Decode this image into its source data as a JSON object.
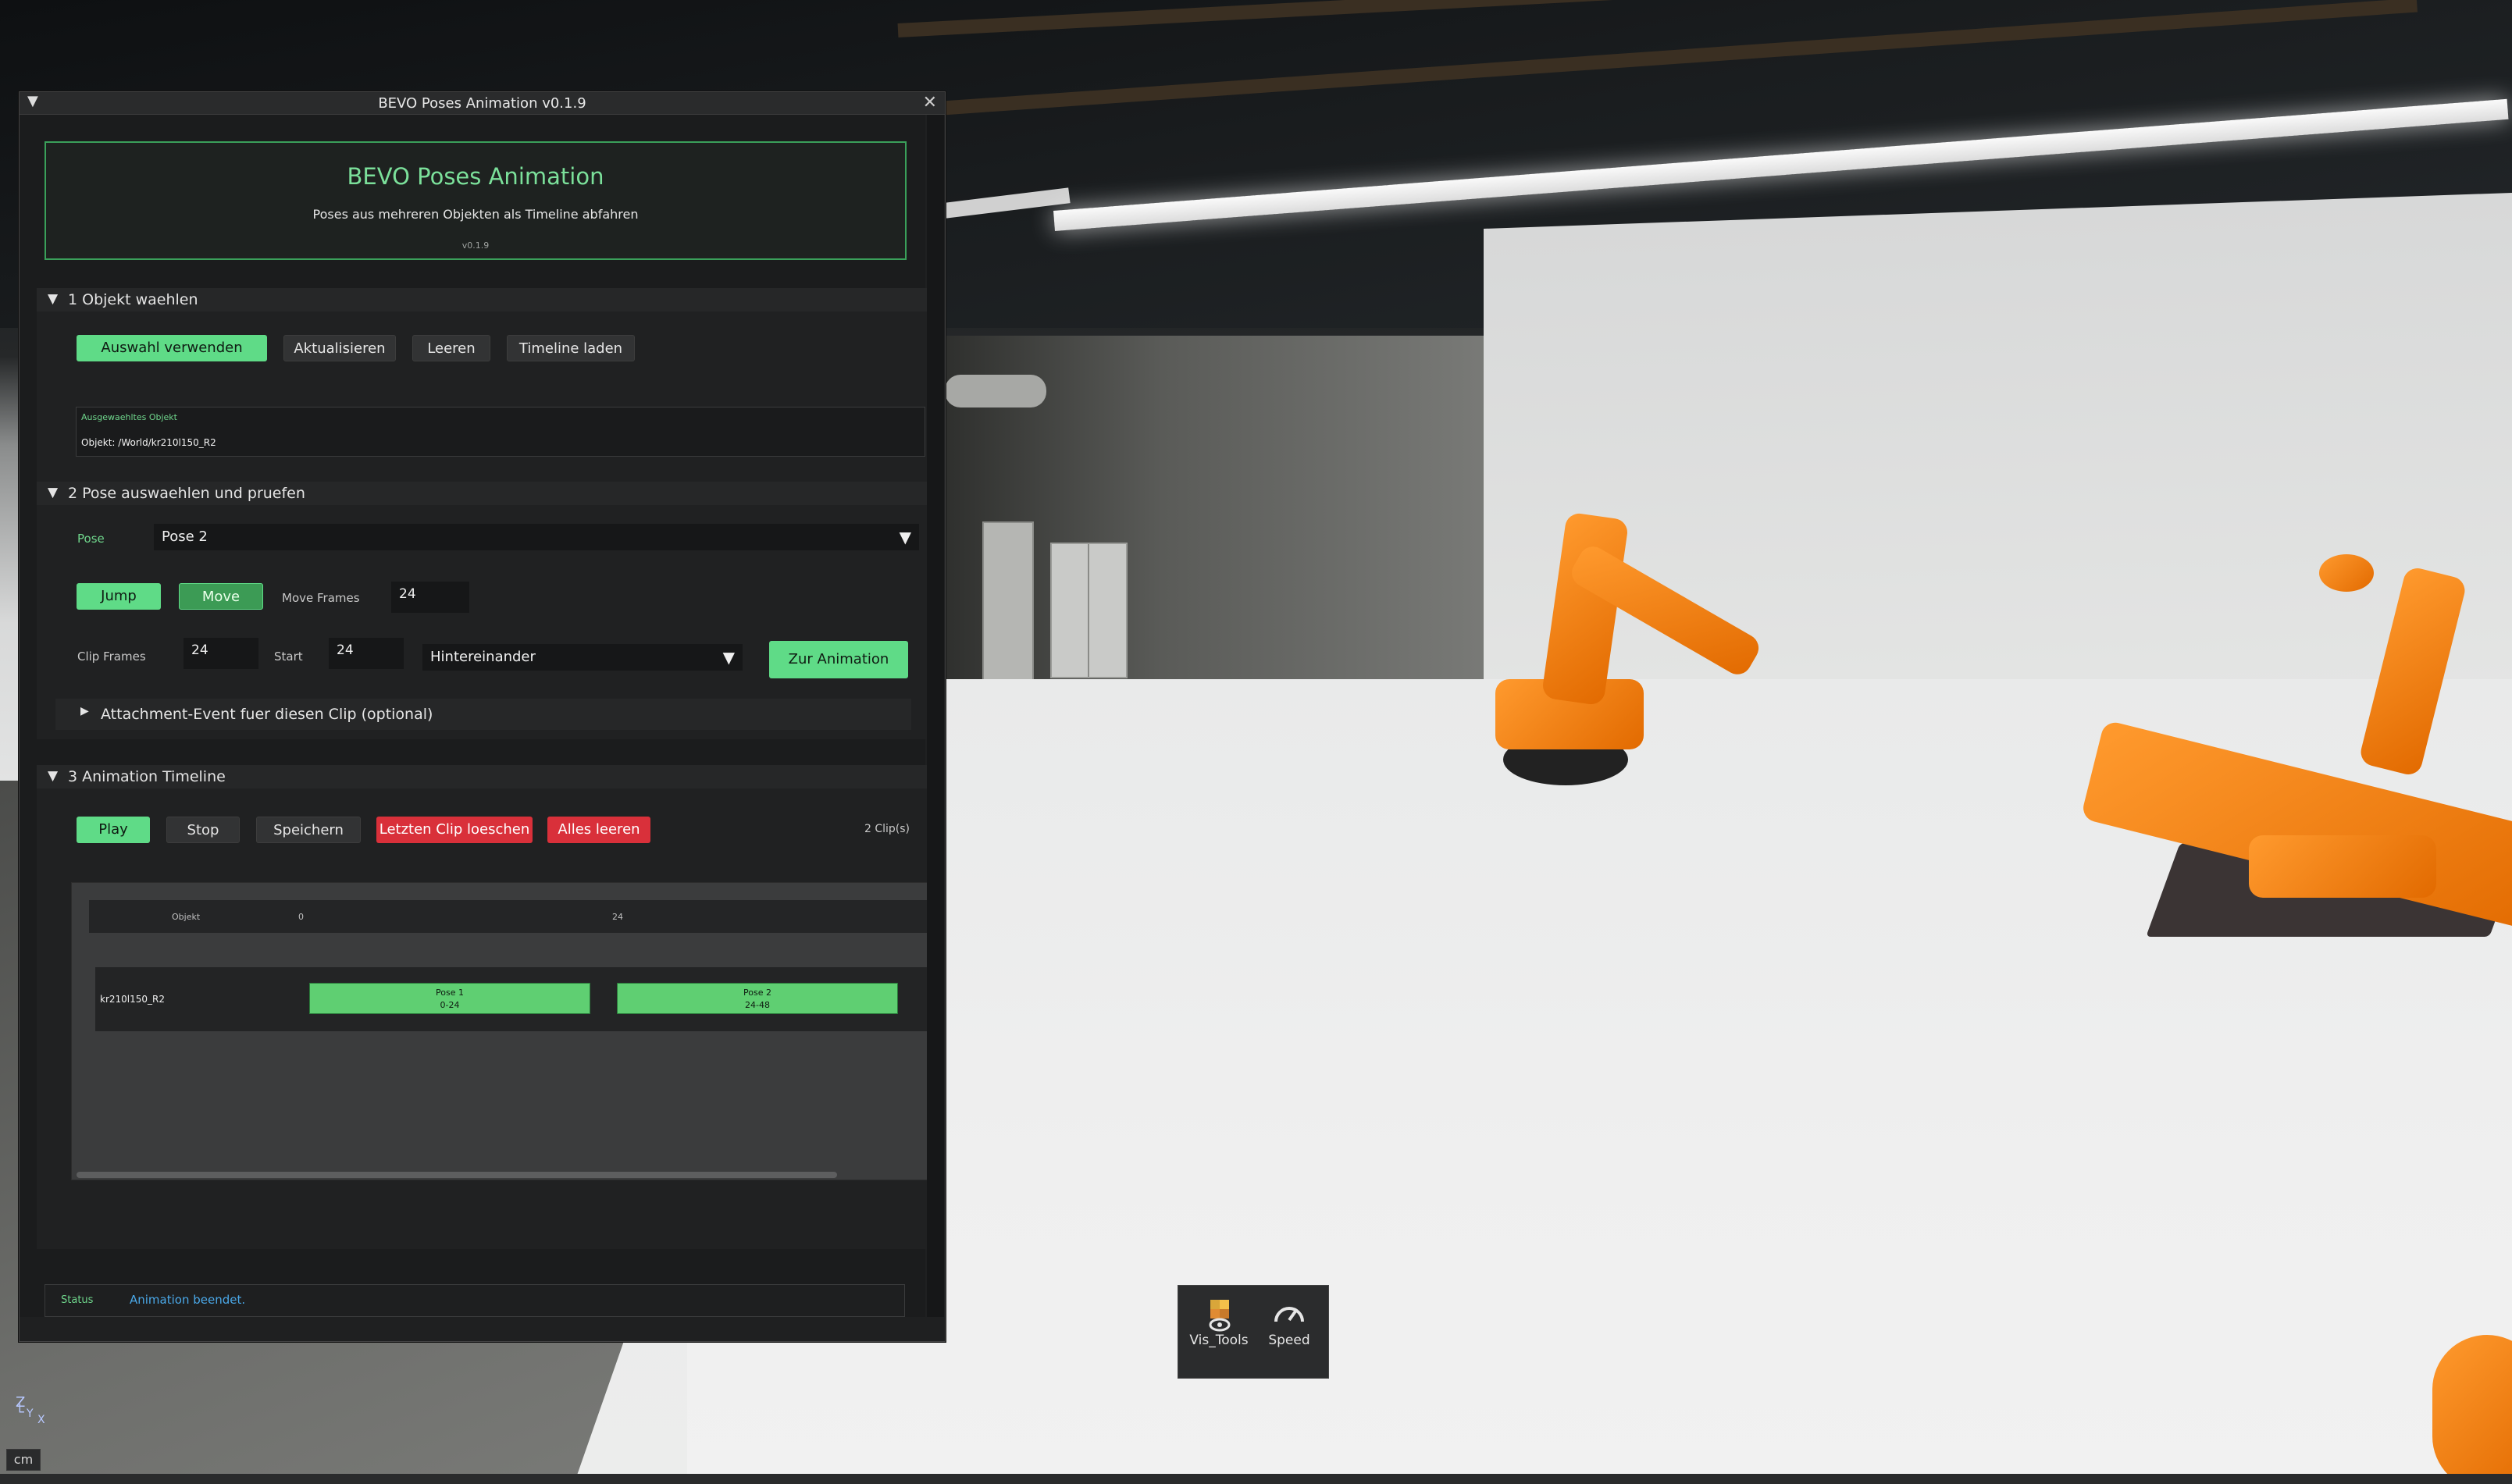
{
  "window": {
    "title": "BEVO Poses Animation v0.1.9"
  },
  "header": {
    "title": "BEVO Poses Animation",
    "subtitle": "Poses aus mehreren Objekten als Timeline abfahren",
    "version": "v0.1.9"
  },
  "section1": {
    "title": "1  Objekt waehlen",
    "buttons": {
      "use_selection": "Auswahl verwenden",
      "refresh": "Aktualisieren",
      "clear": "Leeren",
      "load_timeline": "Timeline laden"
    },
    "selected_label": "Ausgewaehltes Objekt",
    "selected_value": "Objekt: /World/kr210l150_R2"
  },
  "section2": {
    "title": "2  Pose auswaehlen und pruefen",
    "pose_label": "Pose",
    "pose_value": "Pose 2",
    "jump": "Jump",
    "move": "Move",
    "move_frames_label": "Move Frames",
    "move_frames_value": "24",
    "clip_frames_label": "Clip Frames",
    "clip_frames_value": "24",
    "start_label": "Start",
    "start_value": "24",
    "mode_value": "Hintereinander",
    "to_animation": "Zur Animation",
    "attachment": "Attachment-Event fuer diesen Clip (optional)"
  },
  "section3": {
    "title": "3  Animation Timeline",
    "buttons": {
      "play": "Play",
      "stop": "Stop",
      "save": "Speichern",
      "delete_last": "Letzten Clip loeschen",
      "clear_all": "Alles leeren"
    },
    "clip_count": "2 Clip(s)",
    "timeline": {
      "col_object": "Objekt",
      "tick_0": "0",
      "tick_24": "24",
      "row_name": "kr210l150_R2",
      "clips": [
        {
          "name": "Pose 1",
          "range": "0-24"
        },
        {
          "name": "Pose 2",
          "range": "24-48"
        }
      ]
    }
  },
  "status": {
    "label": "Status",
    "value": "Animation beendet."
  },
  "viewport_toolbar": {
    "vis_tools": "Vis_Tools",
    "speed": "Speed"
  },
  "viewport": {
    "axis_z": "Z",
    "axis_x": "X",
    "axis_y": "Y",
    "unit": "cm"
  },
  "colors": {
    "accent_green": "#5fdb87",
    "danger_red": "#d9303a",
    "status_blue": "#4aa8e8",
    "robot_orange": "#f57f12"
  }
}
